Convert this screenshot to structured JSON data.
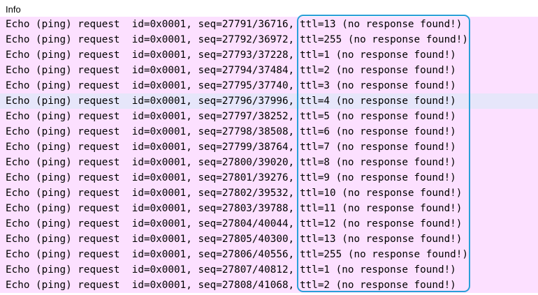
{
  "header": {
    "column_label": "Info"
  },
  "colors": {
    "row_background": "#fce0ff",
    "selected_row_background": "#e6e6fa",
    "highlight_border": "#2a9fd8"
  },
  "packets": [
    {
      "prefix": "Echo (ping) request  id=0x0001, seq=27791/36716,",
      "ttl_info": "ttl=13 (no response found!)",
      "selected": false
    },
    {
      "prefix": "Echo (ping) request  id=0x0001, seq=27792/36972,",
      "ttl_info": "ttl=255 (no response found!)",
      "selected": false
    },
    {
      "prefix": "Echo (ping) request  id=0x0001, seq=27793/37228,",
      "ttl_info": "ttl=1 (no response found!)",
      "selected": false
    },
    {
      "prefix": "Echo (ping) request  id=0x0001, seq=27794/37484,",
      "ttl_info": "ttl=2 (no response found!)",
      "selected": false
    },
    {
      "prefix": "Echo (ping) request  id=0x0001, seq=27795/37740,",
      "ttl_info": "ttl=3 (no response found!)",
      "selected": false
    },
    {
      "prefix": "Echo (ping) request  id=0x0001, seq=27796/37996,",
      "ttl_info": "ttl=4 (no response found!)",
      "selected": true
    },
    {
      "prefix": "Echo (ping) request  id=0x0001, seq=27797/38252,",
      "ttl_info": "ttl=5 (no response found!)",
      "selected": false
    },
    {
      "prefix": "Echo (ping) request  id=0x0001, seq=27798/38508,",
      "ttl_info": "ttl=6 (no response found!)",
      "selected": false
    },
    {
      "prefix": "Echo (ping) request  id=0x0001, seq=27799/38764,",
      "ttl_info": "ttl=7 (no response found!)",
      "selected": false
    },
    {
      "prefix": "Echo (ping) request  id=0x0001, seq=27800/39020,",
      "ttl_info": "ttl=8 (no response found!)",
      "selected": false
    },
    {
      "prefix": "Echo (ping) request  id=0x0001, seq=27801/39276,",
      "ttl_info": "ttl=9 (no response found!)",
      "selected": false
    },
    {
      "prefix": "Echo (ping) request  id=0x0001, seq=27802/39532,",
      "ttl_info": "ttl=10 (no response found!)",
      "selected": false
    },
    {
      "prefix": "Echo (ping) request  id=0x0001, seq=27803/39788,",
      "ttl_info": "ttl=11 (no response found!)",
      "selected": false
    },
    {
      "prefix": "Echo (ping) request  id=0x0001, seq=27804/40044,",
      "ttl_info": "ttl=12 (no response found!)",
      "selected": false
    },
    {
      "prefix": "Echo (ping) request  id=0x0001, seq=27805/40300,",
      "ttl_info": "ttl=13 (no response found!)",
      "selected": false
    },
    {
      "prefix": "Echo (ping) request  id=0x0001, seq=27806/40556,",
      "ttl_info": "ttl=255 (no response found!)",
      "selected": false
    },
    {
      "prefix": "Echo (ping) request  id=0x0001, seq=27807/40812,",
      "ttl_info": "ttl=1 (no response found!)",
      "selected": false
    },
    {
      "prefix": "Echo (ping) request  id=0x0001, seq=27808/41068,",
      "ttl_info": "ttl=2 (no response found!)",
      "selected": false
    }
  ]
}
